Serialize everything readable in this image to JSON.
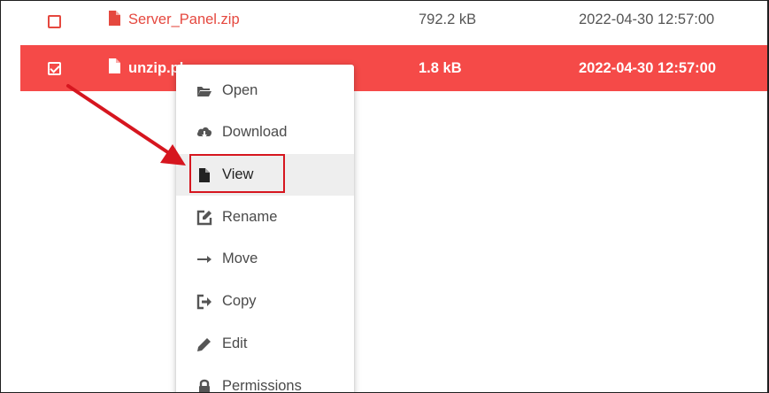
{
  "files": [
    {
      "name": "Server_Panel.zip",
      "size": "792.2 kB",
      "modified": "2022-04-30 12:57:00",
      "selected": false
    },
    {
      "name": "unzip.php",
      "size": "1.8 kB",
      "modified": "2022-04-30 12:57:00",
      "selected": true
    }
  ],
  "context_menu": {
    "items": [
      {
        "label": "Open",
        "icon": "folder-open-icon"
      },
      {
        "label": "Download",
        "icon": "cloud-download-icon"
      },
      {
        "label": "View",
        "icon": "file-icon"
      },
      {
        "label": "Rename",
        "icon": "edit-square-icon"
      },
      {
        "label": "Move",
        "icon": "arrow-right-icon"
      },
      {
        "label": "Copy",
        "icon": "sign-out-icon"
      },
      {
        "label": "Edit",
        "icon": "pencil-icon"
      },
      {
        "label": "Permissions",
        "icon": "lock-icon"
      }
    ],
    "highlighted": "View"
  },
  "colors": {
    "accent": "#f54a48",
    "file_text": "#e5483f",
    "annotation": "#d6161f"
  }
}
